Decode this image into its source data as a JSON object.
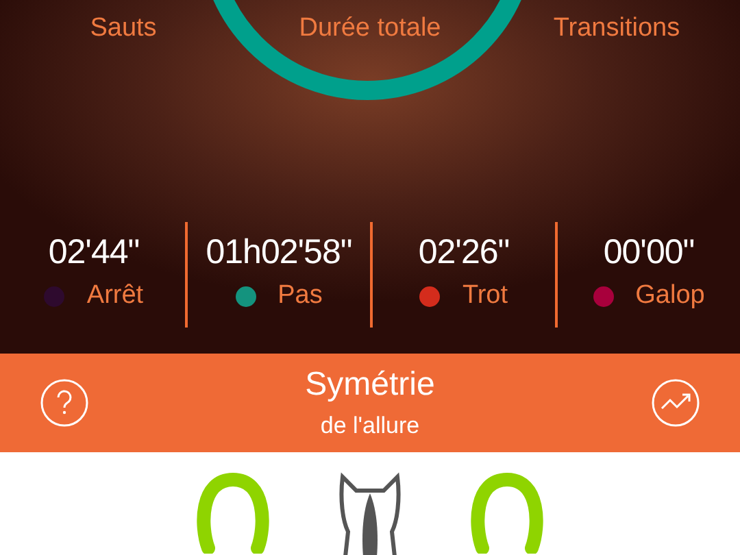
{
  "summary": {
    "labels": [
      "Sauts",
      "Durée totale",
      "Transitions"
    ]
  },
  "gaits": [
    {
      "duration": "02'44\"",
      "name": "Arrêt",
      "color": "#2e0a2e"
    },
    {
      "duration": "01h02'58\"",
      "name": "Pas",
      "color": "#14937e"
    },
    {
      "duration": "02'26\"",
      "name": "Trot",
      "color": "#d42c1c"
    },
    {
      "duration": "00'00\"",
      "name": "Galop",
      "color": "#a8003c"
    }
  ],
  "symmetry_bar": {
    "title": "Symétrie",
    "subtitle": "de l'allure"
  }
}
